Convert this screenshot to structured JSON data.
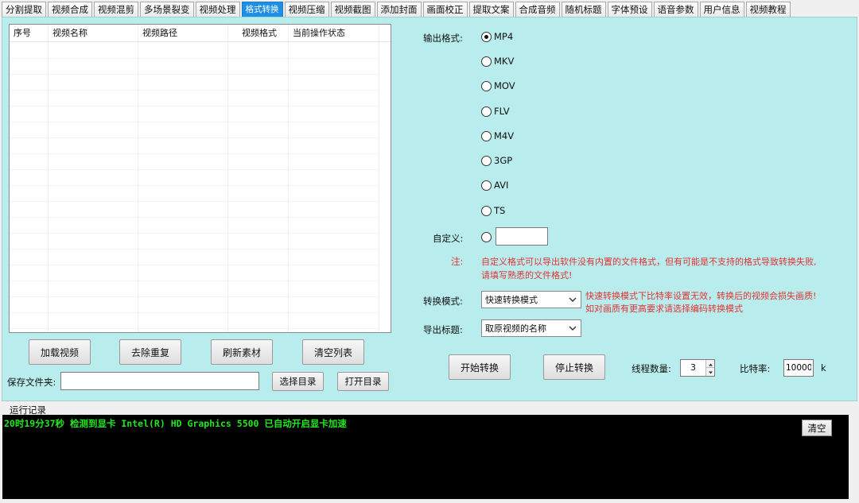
{
  "tabs": [
    {
      "label": "分割提取"
    },
    {
      "label": "视频合成"
    },
    {
      "label": "视频混剪"
    },
    {
      "label": "多场景裂变"
    },
    {
      "label": "视频处理"
    },
    {
      "label": "格式转换"
    },
    {
      "label": "视频压缩"
    },
    {
      "label": "视频截图"
    },
    {
      "label": "添加封面"
    },
    {
      "label": "画面校正"
    },
    {
      "label": "提取文案"
    },
    {
      "label": "合成音频"
    },
    {
      "label": "随机标题"
    },
    {
      "label": "字体预设"
    },
    {
      "label": "语音参数"
    },
    {
      "label": "用户信息"
    },
    {
      "label": "视频教程"
    }
  ],
  "active_tab": "格式转换",
  "list": {
    "columns": [
      "序号",
      "视频名称",
      "视频路径",
      "视频格式",
      "当前操作状态"
    ]
  },
  "buttons": {
    "load": "加载视频",
    "dedupe": "去除重复",
    "refresh": "刷新素材",
    "clear_list": "清空列表",
    "choose_dir": "选择目录",
    "open_dir": "打开目录",
    "start": "开始转换",
    "stop": "停止转换",
    "clear_log": "清空"
  },
  "save_folder": {
    "label": "保存文件夹:",
    "value": ""
  },
  "output_format": {
    "label": "输出格式:",
    "options": [
      "MP4",
      "MKV",
      "MOV",
      "FLV",
      "M4V",
      "3GP",
      "AVI",
      "TS"
    ],
    "selected": "MP4"
  },
  "custom": {
    "label": "自定义:",
    "value": ""
  },
  "note": {
    "label": "注:",
    "line1": "自定义格式可以导出软件没有内置的文件格式，但有可能是不支持的格式导致转换失败,",
    "line2": "请填写熟悉的文件格式!"
  },
  "convert_mode": {
    "label": "转换模式:",
    "value": "快速转换模式",
    "hint1": "快速转换模式下比特率设置无效，转换后的视频会损失画质!",
    "hint2": "如对画质有更高要求请选择编码转换模式"
  },
  "export_title": {
    "label": "导出标题:",
    "value": "取原视频的名称"
  },
  "threads": {
    "label": "线程数量:",
    "value": "3"
  },
  "bitrate": {
    "label": "比特率:",
    "value": "10000",
    "unit": "k"
  },
  "log": {
    "title": "运行记录",
    "line": "20时19分37秒 检测到显卡 Intel(R) HD Graphics 5500 已自动开启显卡加速"
  },
  "colors": {
    "panel_bg": "#b9ecec",
    "active_tab": "#1f8fe6",
    "note_red": "#e23333",
    "log_green": "#21e621"
  }
}
